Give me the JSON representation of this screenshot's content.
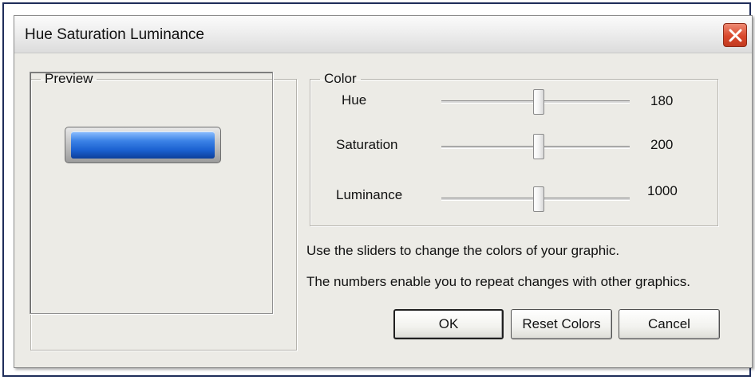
{
  "window": {
    "title": "Hue Saturation Luminance",
    "close_icon": "close-icon"
  },
  "preview": {
    "label": "Preview"
  },
  "color": {
    "label": "Color",
    "sliders": [
      {
        "label": "Hue",
        "value": "180",
        "position_fraction": 0.5
      },
      {
        "label": "Saturation",
        "value": "200",
        "position_fraction": 0.5
      },
      {
        "label": "Luminance",
        "value": "1000",
        "position_fraction": 0.5
      }
    ]
  },
  "help": {
    "line1": "Use the sliders to change the colors of your graphic.",
    "line2": "The numbers enable you to repeat changes with other graphics."
  },
  "buttons": {
    "ok": "OK",
    "reset": "Reset Colors",
    "cancel": "Cancel"
  },
  "colors": {
    "close_button": "#d9482c",
    "preview_fill": "#1a5fcf",
    "dialog_bg": "#ecebe6"
  }
}
